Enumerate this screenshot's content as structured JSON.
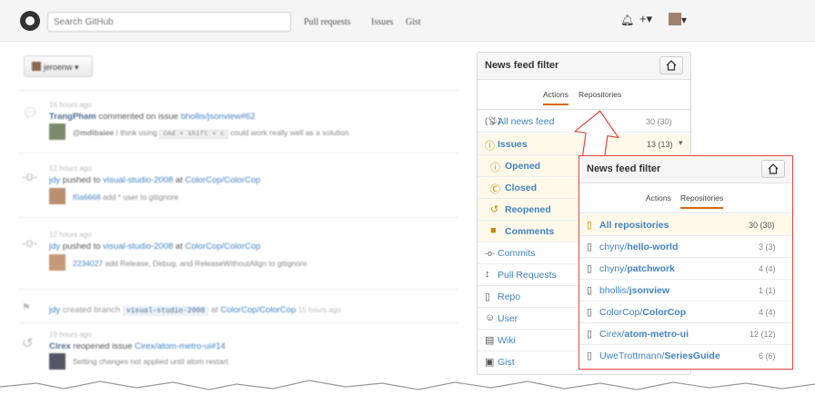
{
  "header": {
    "search_placeholder": "Search GitHub",
    "nav": [
      "Pull requests",
      "Issues",
      "Gist"
    ],
    "icons": [
      "bell-icon",
      "plus-icon",
      "avatar"
    ]
  },
  "feed": {
    "context_button": "jeroenw",
    "items": [
      {
        "time": "16 hours ago",
        "actor": "TrangPham",
        "action": "commented on issue",
        "target": "bhollis/jsonview#62",
        "sub_user": "@mdibaiee",
        "sub_text": "I think using",
        "sub_code": "cmd + shift + c",
        "sub_text2": "could work really well as a solution"
      },
      {
        "time": "12 hours ago",
        "actor": "jdy",
        "action": "pushed to",
        "branch": "visual-studio-2008",
        "at": "at",
        "repo": "ColorCop/ColorCop",
        "sha": "f0a6668",
        "commit": "add * user to gitignore"
      },
      {
        "time": "12 hours ago",
        "actor": "jdy",
        "action": "pushed to",
        "branch": "visual-studio-2008",
        "at": "at",
        "repo": "ColorCop/ColorCop",
        "sha": "2234027",
        "commit": "add Release, Debug, and ReleaseWithoutAlign to gitignore"
      },
      {
        "actor": "jdy",
        "action": "created branch",
        "branch": "visual-studio-2008",
        "at": "at",
        "repo": "ColorCop/ColorCop",
        "time": "15 hours ago"
      },
      {
        "time": "19 hours ago",
        "actor": "Cirex",
        "action": "reopened issue",
        "target": "Cirex/atom-metro-ui#14",
        "sub_text": "Setting changes not applied until atom restart"
      }
    ]
  },
  "filter_panel": {
    "title": "News feed filter",
    "tabs": [
      "Actions",
      "Repositories"
    ],
    "selected_tab": "Actions",
    "rows": [
      {
        "label": "All news feed",
        "count": "30 (30)",
        "icon": "broadcast-icon"
      },
      {
        "label": "Issues",
        "count": "13 (13)",
        "icon": "issue-icon"
      },
      {
        "label": "Opened",
        "icon": "issue-opened-icon"
      },
      {
        "label": "Closed",
        "icon": "issue-closed-icon"
      },
      {
        "label": "Reopened",
        "icon": "issue-reopened-icon"
      },
      {
        "label": "Comments",
        "icon": "comment-icon"
      },
      {
        "label": "Commits",
        "icon": "commit-icon"
      },
      {
        "label": "Pull Requests",
        "icon": "pull-request-icon"
      },
      {
        "label": "Repo",
        "icon": "repo-icon"
      },
      {
        "label": "User",
        "icon": "person-icon"
      },
      {
        "label": "Wiki",
        "icon": "book-icon"
      },
      {
        "label": "Gist",
        "icon": "gist-icon"
      }
    ]
  },
  "repo_panel": {
    "title": "News feed filter",
    "tabs": [
      "Actions",
      "Repositories"
    ],
    "selected_tab": "Repositories",
    "rows": [
      {
        "owner": "",
        "name": "All repositories",
        "count": "30 (30)"
      },
      {
        "owner": "chyny/",
        "name": "hello-world",
        "count": "3 (3)"
      },
      {
        "owner": "chyny/",
        "name": "patchwork",
        "count": "4 (4)"
      },
      {
        "owner": "bhollis/",
        "name": "jsonview",
        "count": "1 (1)"
      },
      {
        "owner": "ColorCop/",
        "name": "ColorCop",
        "count": "4 (4)"
      },
      {
        "owner": "Cirex/",
        "name": "atom-metro-ui",
        "count": "12 (12)"
      },
      {
        "owner": "UweTrottmann/",
        "name": "SeriesGuide",
        "count": "6 (6)"
      }
    ]
  },
  "colors": {
    "accent": "#d26911",
    "link": "#4183c4",
    "callout_border": "#e0463f",
    "highlight": "#fef9e9"
  }
}
